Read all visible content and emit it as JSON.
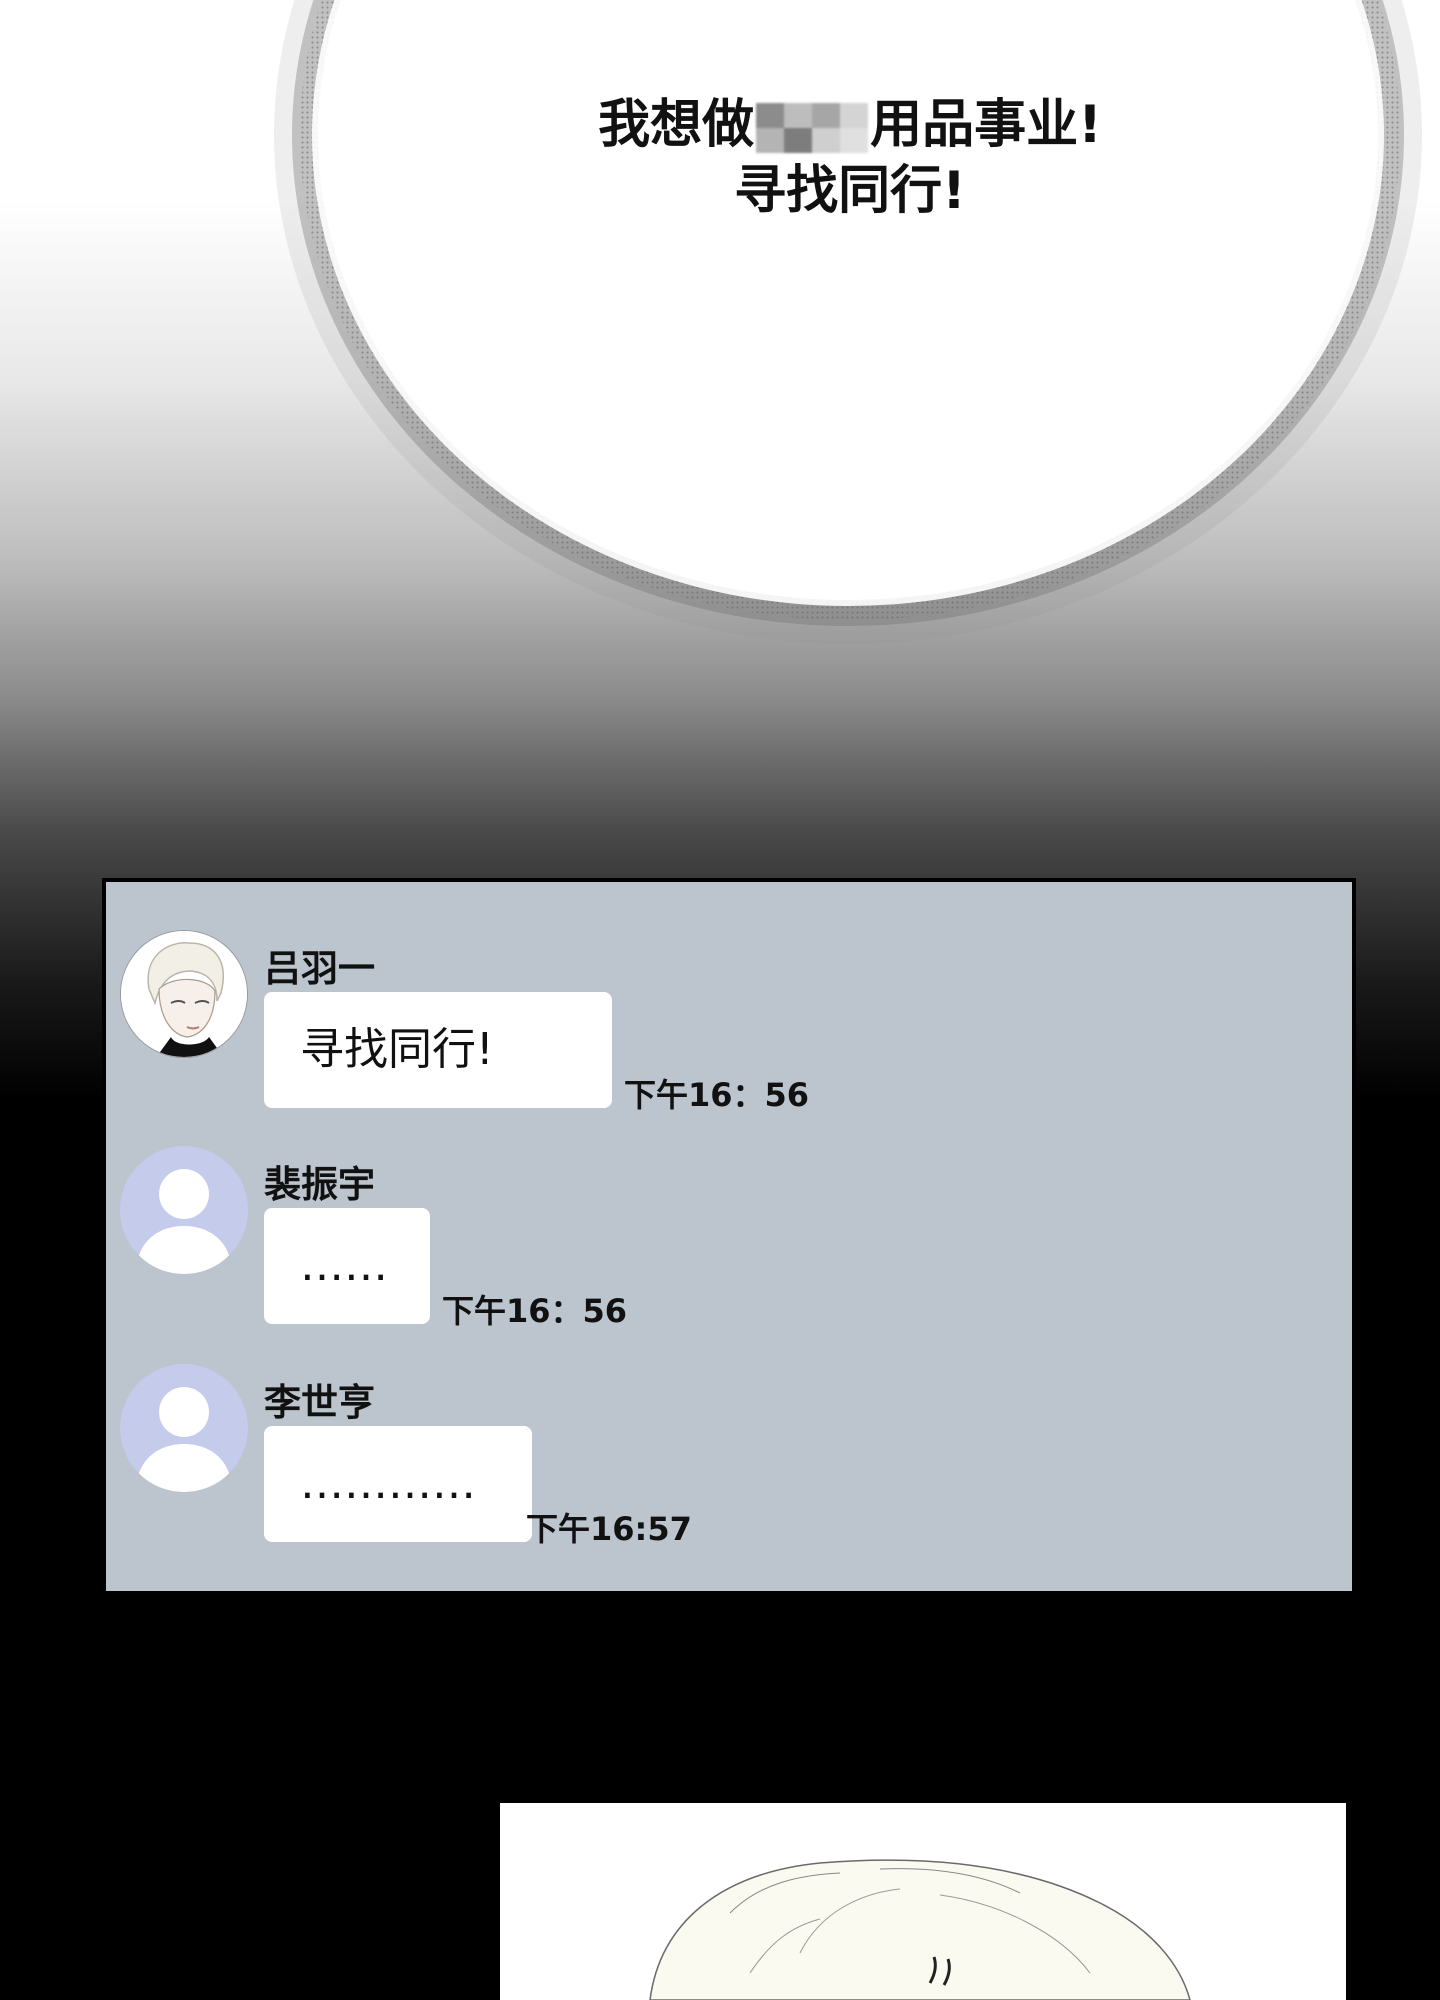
{
  "speech_bubble": {
    "line1_before": "我想做",
    "line1_after": "用品事业!",
    "line2": "寻找同行!"
  },
  "chat": {
    "messages": [
      {
        "sender": "吕羽一",
        "text": "寻找同行!",
        "time": "下午16：56"
      },
      {
        "sender": "裴振宇",
        "text": "……",
        "time": "下午16：56"
      },
      {
        "sender": "李世亨",
        "text": "…………",
        "time": "下午16:57"
      }
    ]
  },
  "colors": {
    "chat_background": "#bcc4ce",
    "default_avatar": "#c5cbeb",
    "message_bubble": "#ffffff"
  }
}
